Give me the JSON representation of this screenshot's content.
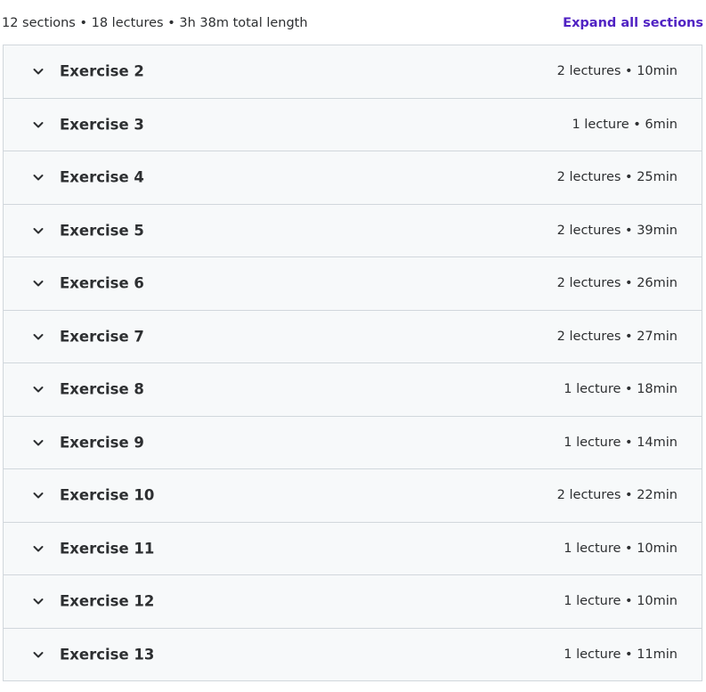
{
  "summary": {
    "text": "12 sections • 18 lectures • 3h 38m total length",
    "expand_label": "Expand all sections"
  },
  "colors": {
    "link": "#5022c3",
    "row_bg": "#f7f9fa",
    "border": "#d1d7dc",
    "text": "#2d2f31"
  },
  "icons": {
    "row_toggle": "chevron-down-icon"
  },
  "sections": [
    {
      "title": "Exercise 2",
      "meta": "2 lectures • 10min"
    },
    {
      "title": "Exercise 3",
      "meta": "1 lecture • 6min"
    },
    {
      "title": "Exercise 4",
      "meta": "2 lectures • 25min"
    },
    {
      "title": "Exercise 5",
      "meta": "2 lectures • 39min"
    },
    {
      "title": "Exercise 6",
      "meta": "2 lectures • 26min"
    },
    {
      "title": "Exercise 7",
      "meta": "2 lectures • 27min"
    },
    {
      "title": "Exercise 8",
      "meta": "1 lecture • 18min"
    },
    {
      "title": "Exercise 9",
      "meta": "1 lecture • 14min"
    },
    {
      "title": "Exercise 10",
      "meta": "2 lectures • 22min"
    },
    {
      "title": "Exercise 11",
      "meta": "1 lecture • 10min"
    },
    {
      "title": "Exercise 12",
      "meta": "1 lecture • 10min"
    },
    {
      "title": "Exercise 13",
      "meta": "1 lecture • 11min"
    }
  ]
}
